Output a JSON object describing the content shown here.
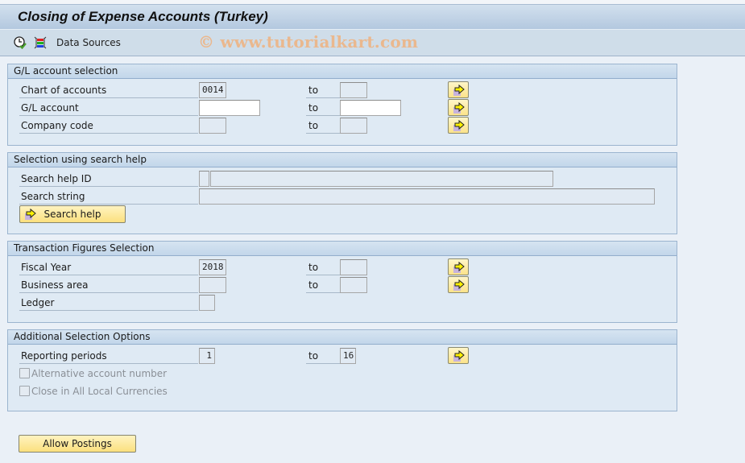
{
  "window": {
    "title": "Closing of Expense Accounts (Turkey)",
    "watermark": "© www.tutorialkart.com"
  },
  "toolbar": {
    "items": [
      {
        "icon": "execute-clock-icon"
      },
      {
        "icon": "selection-options-icon"
      },
      {
        "label": "Data Sources"
      }
    ]
  },
  "groups": {
    "gl": {
      "title": "G/L account selection",
      "rows": [
        {
          "label": "Chart of accounts",
          "from": "0014",
          "to_label": "to",
          "to": ""
        },
        {
          "label": "G/L account",
          "from": "",
          "to_label": "to",
          "to": ""
        },
        {
          "label": "Company code",
          "from": "",
          "to_label": "to",
          "to": ""
        }
      ]
    },
    "search": {
      "title": "Selection using search help",
      "rows": [
        {
          "label": "Search help ID",
          "value": "",
          "desc": ""
        },
        {
          "label": "Search string",
          "value": ""
        }
      ],
      "button": "Search help"
    },
    "trans": {
      "title": "Transaction Figures Selection",
      "rows": [
        {
          "label": "Fiscal Year",
          "from": "2018",
          "to_label": "to",
          "to": ""
        },
        {
          "label": "Business area",
          "from": "",
          "to_label": "to",
          "to": ""
        },
        {
          "label": "Ledger",
          "from": ""
        }
      ]
    },
    "additional": {
      "title": "Additional Selection Options",
      "rows": [
        {
          "label": "Reporting periods",
          "from": "1",
          "to_label": "to",
          "to": "16"
        }
      ],
      "checkboxes": [
        {
          "label": "Alternative account number",
          "checked": false,
          "enabled": false
        },
        {
          "label": "Close in All Local Currencies",
          "checked": false,
          "enabled": false
        }
      ]
    }
  },
  "footer": {
    "allow_postings": "Allow Postings"
  },
  "colors": {
    "button_yellow": "#fbe38a",
    "panel_bg": "#dfeaf4",
    "watermark": "#efb27f"
  }
}
